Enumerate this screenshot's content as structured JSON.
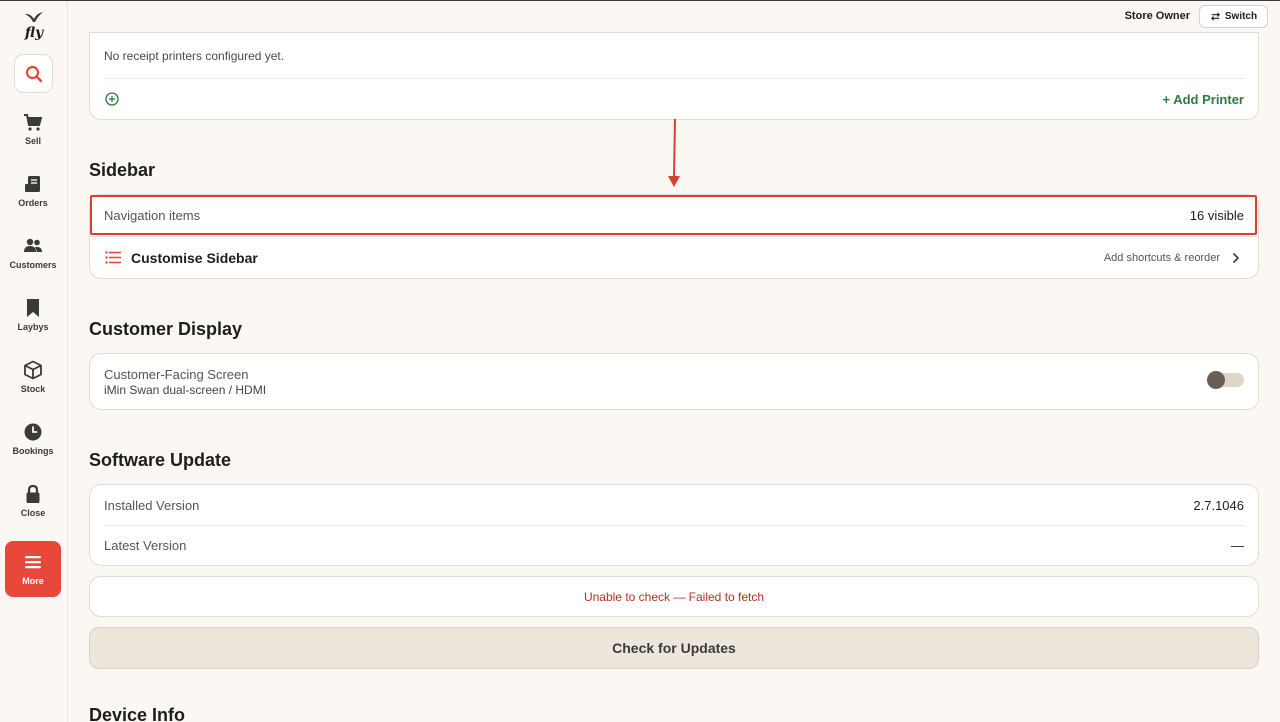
{
  "app": {
    "logo_text": "fly"
  },
  "header": {
    "user_role": "Store Owner",
    "switch_label": "Switch"
  },
  "nav": {
    "items": [
      {
        "label": "Sell",
        "icon": "cart-icon"
      },
      {
        "label": "Orders",
        "icon": "receipt-icon"
      },
      {
        "label": "Customers",
        "icon": "people-icon"
      },
      {
        "label": "Laybys",
        "icon": "bookmark-icon"
      },
      {
        "label": "Stock",
        "icon": "box-icon"
      },
      {
        "label": "Bookings",
        "icon": "clock-icon"
      },
      {
        "label": "Close",
        "icon": "lock-icon"
      },
      {
        "label": "More",
        "icon": "menu-icon",
        "active": true
      }
    ]
  },
  "printers": {
    "empty_message": "No receipt printers configured yet.",
    "add_label": "+ Add Printer"
  },
  "sidebar_section": {
    "title": "Sidebar",
    "nav_items_label": "Navigation items",
    "nav_items_value": "16 visible",
    "customise_label": "Customise Sidebar",
    "customise_hint": "Add shortcuts & reorder"
  },
  "customer_display": {
    "title": "Customer Display",
    "screen_label": "Customer-Facing Screen",
    "screen_sub": "iMin Swan dual-screen / HDMI",
    "enabled": false
  },
  "software_update": {
    "title": "Software Update",
    "installed_label": "Installed Version",
    "installed_value": "2.7.1046",
    "latest_label": "Latest Version",
    "latest_value": "—",
    "error_message": "Unable to check — Failed to fetch",
    "check_button": "Check for Updates"
  },
  "device_info": {
    "title": "Device Info"
  },
  "colors": {
    "accent": "#e8483a",
    "success": "#2f7a3e",
    "error": "#b53027",
    "annotation": "#d9412e"
  }
}
